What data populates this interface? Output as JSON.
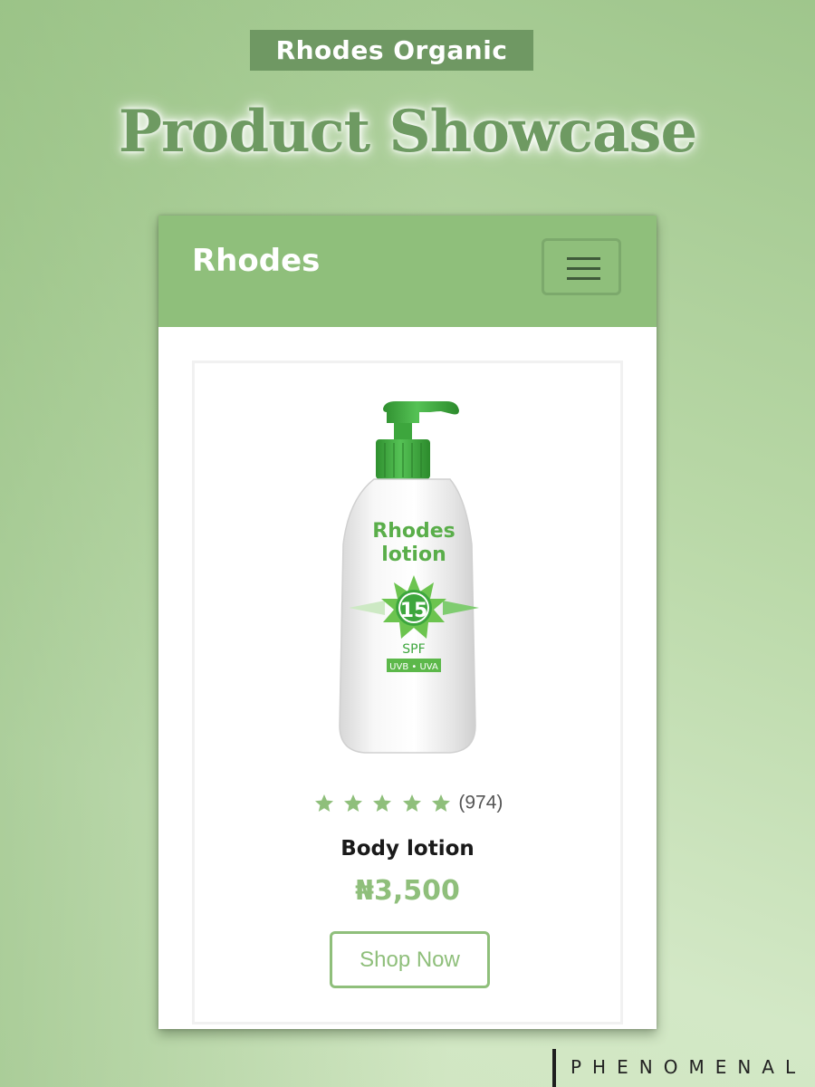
{
  "header": {
    "brand_pill": "Rhodes Organic",
    "headline": "Product Showcase"
  },
  "navbar": {
    "brand": "Rhodes",
    "menu_icon": "hamburger-menu-icon"
  },
  "product": {
    "image_icon": "lotion-bottle-icon",
    "bottle_label": {
      "line1": "Rhodes",
      "line2": "lotion",
      "spf_number": "15",
      "spf": "SPF",
      "uv": "UVB • UVA"
    },
    "rating": {
      "stars": 5,
      "max_stars": 5,
      "count": "(974)"
    },
    "name": "Body lotion",
    "price": "₦3,500",
    "cta": "Shop Now"
  },
  "watermark": "PHENOMENAL",
  "colors": {
    "accent": "#8fbf7b",
    "brand_pill_bg": "#6f9863",
    "headline": "#6e9a62",
    "bottle_cap": "#3aa53a"
  }
}
